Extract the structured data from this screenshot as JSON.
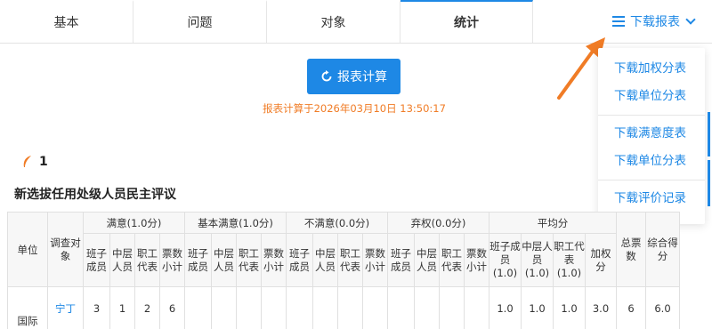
{
  "tabs": [
    {
      "label": "基本"
    },
    {
      "label": "问题"
    },
    {
      "label": "对象"
    },
    {
      "label": "统计"
    }
  ],
  "download_menu": {
    "label": "下载报表",
    "items": [
      "下载加权分表",
      "下载单位分表",
      "下载满意度表",
      "下载单位分表",
      "下载评价记录"
    ]
  },
  "calc": {
    "button_label": "报表计算",
    "time_text": "报表计算于2026年03月10日 13:50:17"
  },
  "section": {
    "number": "1",
    "title": "新选拔任用处级人员民主评议"
  },
  "table": {
    "col_unit": "单位",
    "col_object": "调查对象",
    "groups": [
      "满意(1.0分)",
      "基本满意(1.0分)",
      "不满意(0.0分)",
      "弃权(0.0分)",
      "平均分"
    ],
    "sub_a": "班子成员",
    "sub_b": "中层人员",
    "sub_c": "职工代表",
    "sub_d": "票数小计",
    "avg_a": "班子成员(1.0)",
    "avg_b": "中层人员(1.0)",
    "avg_c": "职工代表(1.0)",
    "avg_d": "加权分",
    "col_total": "总票数",
    "col_score": "综合得分",
    "rows": [
      {
        "unit": "国际",
        "object": "宁丁",
        "cells": [
          "3",
          "1",
          "2",
          "6",
          "",
          "",
          "",
          "",
          "",
          "",
          "",
          "",
          "",
          "",
          "",
          "",
          "1.0",
          "1.0",
          "1.0",
          "3.0",
          "6",
          "6.0"
        ]
      }
    ]
  },
  "colors": {
    "accent": "#1e88e5",
    "orange": "#f07c26"
  }
}
